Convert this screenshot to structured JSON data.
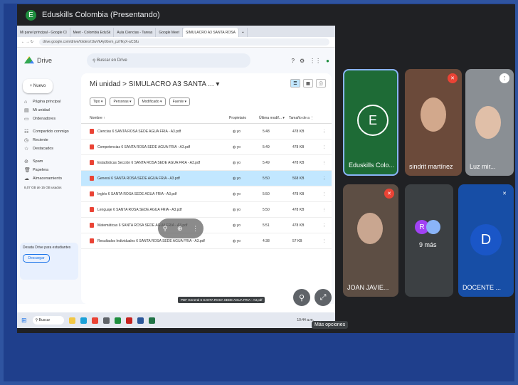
{
  "meeting": {
    "title": "Eduskills Colombia (Presentando)",
    "presenter_initial": "E",
    "more_options_tooltip": "Más opciones"
  },
  "browser": {
    "tabs": [
      "Mi panel principal - Google Cl",
      "Meet - Colombia EduSk",
      "Aula Ciencias - Tareas",
      "Google Meet",
      "SIMULACRO A3 SANTA ROSA",
      "+"
    ],
    "url": "drive.google.com/drive/folders/1lwVkAy9bvm_pzHkyX-aCSfu"
  },
  "drive": {
    "app_name": "Drive",
    "search_placeholder": "Buscar en Drive",
    "new_label": "Nuevo",
    "sidebar": [
      {
        "icon": "home-icon",
        "glyph": "⌂",
        "label": "Página principal"
      },
      {
        "icon": "drive-icon",
        "glyph": "▤",
        "label": "Mi unidad"
      },
      {
        "icon": "computers-icon",
        "glyph": "▭",
        "label": "Ordenadores"
      },
      {
        "icon": "shared-icon",
        "glyph": "☷",
        "label": "Compartido conmigo"
      },
      {
        "icon": "recent-icon",
        "glyph": "◷",
        "label": "Reciente"
      },
      {
        "icon": "starred-icon",
        "glyph": "☆",
        "label": "Destacados"
      },
      {
        "icon": "spam-icon",
        "glyph": "⊘",
        "label": "Spam"
      },
      {
        "icon": "trash-icon",
        "glyph": "🗑",
        "label": "Papelera"
      },
      {
        "icon": "storage-icon",
        "glyph": "☁",
        "label": "Almacenamiento"
      }
    ],
    "storage_used": "8,07 GB de 15 GB usados",
    "storage_card_text": "Desata Drive para estudiantes",
    "storage_button": "Descargar",
    "breadcrumb": "Mi unidad  >  SIMULACRO A3 SANTA ...  ▾",
    "filters": [
      "Tipo ▾",
      "Personas ▾",
      "Modificado ▾",
      "Fuente ▾"
    ],
    "columns": {
      "name": "Nombre ↑",
      "owner": "Propietario",
      "date": "Última modif... ▾",
      "size": "Tamaño de a ⋮"
    },
    "files": [
      {
        "name": "Ciencias 6 SANTA ROSA SEDE AGUA FRIA - A3.pdf",
        "owner": "yo",
        "date": "5:48",
        "size": "478 KB",
        "selected": false
      },
      {
        "name": "Competencias 6 SANTA ROSA SEDE AGUA FRIA - A3.pdf",
        "owner": "yo",
        "date": "5:49",
        "size": "478 KB",
        "selected": false
      },
      {
        "name": "Estadísticas Sección 6 SANTA ROSA SEDE AGUA FRIA - A3.pdf",
        "owner": "yo",
        "date": "5:49",
        "size": "478 KB",
        "selected": false
      },
      {
        "name": "General 6 SANTA ROSA SEDE AGUA FRIA - A3.pdf",
        "owner": "yo",
        "date": "5:50",
        "size": "568 KB",
        "selected": true
      },
      {
        "name": "Inglés 6 SANTA ROSA SEDE AGUA FRIA - A3.pdf",
        "owner": "yo",
        "date": "5:50",
        "size": "478 KB",
        "selected": false
      },
      {
        "name": "Lenguaje 6 SANTA ROSA SEDE AGUA FRIA - A3.pdf",
        "owner": "yo",
        "date": "5:50",
        "size": "478 KB",
        "selected": false
      },
      {
        "name": "Matemáticas 6 SANTA ROSA SEDE AGUA FRIA - A3.pdf",
        "owner": "yo",
        "date": "5:51",
        "size": "478 KB",
        "selected": false
      },
      {
        "name": "Resultados Individuales 6 SANTA ROSA SEDE AGUA FRIA - A3.pdf",
        "owner": "yo",
        "date": "4:38",
        "size": "57 KB",
        "selected": false
      }
    ],
    "row_tooltip": "PDF General 6 SANTA ROSA SEDE AGUA FRIA - A3.pdf"
  },
  "taskbar": {
    "search_label": "Buscar",
    "time": "10:44 a.m."
  },
  "participants": [
    {
      "name": "Eduskills Colo...",
      "initial": "E",
      "type": "letter",
      "color": "#1e6b36",
      "mic_muted": false,
      "highlight": true
    },
    {
      "name": "sindrit martínez",
      "type": "video",
      "mic_muted": true
    },
    {
      "name": "Luz mir...",
      "type": "video",
      "mic_muted": false
    },
    {
      "name": "JOAN JAVIE...",
      "type": "video",
      "mic_muted": true
    },
    {
      "name": "9 más",
      "type": "group",
      "initial": "R"
    },
    {
      "name": "DOCENTE ...",
      "initial": "D",
      "type": "letter",
      "color": "#1a56c7",
      "mic_muted": false
    }
  ],
  "colors": {
    "frame": "#2f54a0",
    "meet_bg": "#202124",
    "accent_green": "#1e8e3e",
    "tile_blue": "#174ea6"
  }
}
